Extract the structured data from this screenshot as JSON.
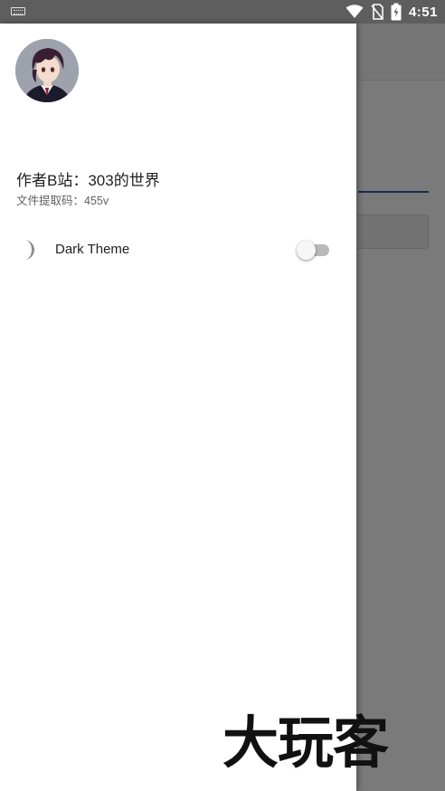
{
  "status_bar": {
    "time": "4:51",
    "icons": [
      "keyboard-icon",
      "wifi-icon",
      "no-sim-icon",
      "battery-charging-icon"
    ]
  },
  "drawer": {
    "avatar": "anime-character-avatar",
    "author_title": "作者B站：303的世界",
    "author_subtitle": "文件提取码：455v",
    "theme_row": {
      "icon": "moon-icon",
      "label": "Dark Theme",
      "switch_on": false
    }
  },
  "watermark": "大玩客",
  "colors": {
    "scrim": "#000000",
    "accent_underline": "#3a5aa8",
    "switch_track_off": "#b9b9b9"
  }
}
